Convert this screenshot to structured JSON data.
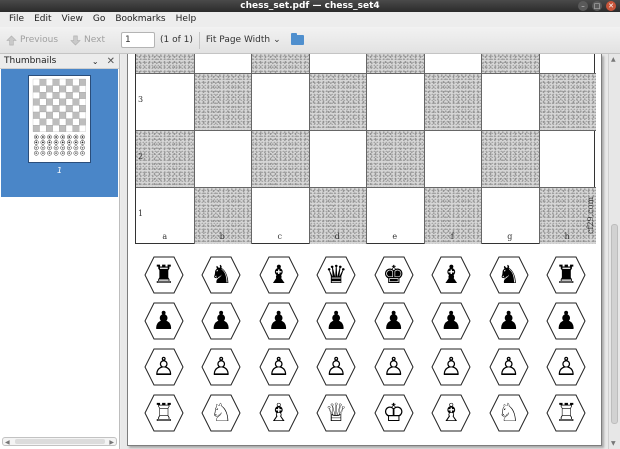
{
  "window": {
    "title": "chess_set.pdf — chess_set4",
    "buttons": [
      "–",
      "□",
      "✕"
    ]
  },
  "menu": [
    "File",
    "Edit",
    "View",
    "Go",
    "Bookmarks",
    "Help"
  ],
  "toolbar": {
    "previous_label": "Previous",
    "next_label": "Next",
    "page_value": "1",
    "page_count": "(1 of 1)",
    "zoom_label": "Fit Page Width",
    "zoom_arrow": "⌄",
    "icons": [
      "arrow-up-icon",
      "arrow-down-icon",
      "folder-icon"
    ]
  },
  "sidebar": {
    "title": "Thumbnails",
    "dropdown_glyph": "⌄",
    "close_glyph": "✕",
    "thumbnail_number": "1"
  },
  "document": {
    "ranks": [
      "3",
      "2",
      "1"
    ],
    "files": [
      "a",
      "b",
      "c",
      "d",
      "e",
      "f",
      "g",
      "h"
    ],
    "brand": "cf29.com",
    "piece_rows": [
      [
        "♜",
        "♞",
        "♝",
        "♛",
        "♚",
        "♝",
        "♞",
        "♜"
      ],
      [
        "♟",
        "♟",
        "♟",
        "♟",
        "♟",
        "♟",
        "♟",
        "♟"
      ],
      [
        "♙",
        "♙",
        "♙",
        "♙",
        "♙",
        "♙",
        "♙",
        "♙"
      ],
      [
        "♖",
        "♘",
        "♗",
        "♕",
        "♔",
        "♗",
        "♘",
        "♖"
      ]
    ]
  }
}
